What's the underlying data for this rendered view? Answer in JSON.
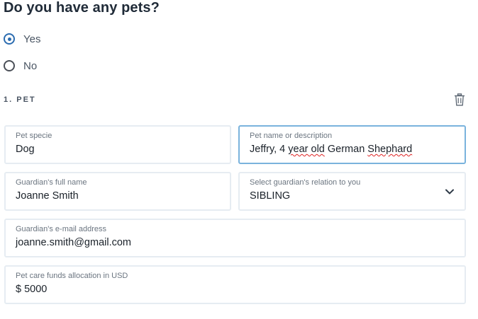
{
  "question": "Do you have any pets?",
  "radio": {
    "options": [
      {
        "label": "Yes",
        "checked": true
      },
      {
        "label": "No",
        "checked": false
      }
    ]
  },
  "section": {
    "title": "1. PET",
    "delete_icon": "trash-icon"
  },
  "fields": {
    "pet_specie": {
      "label": "Pet specie",
      "value": "Dog"
    },
    "pet_name": {
      "label": "Pet name or description",
      "value_part1": "Jeffry, 4 ",
      "value_part2": "year old",
      "value_part3": " German ",
      "value_part4": "Shephard"
    },
    "guardian_name": {
      "label": "Guardian's full name",
      "value": "Joanne Smith"
    },
    "guardian_relation": {
      "label": "Select guardian's relation to you",
      "value": "SIBLING",
      "icon": "chevron-down-icon"
    },
    "guardian_email": {
      "label": "Guardian's e-mail address",
      "value": "joanne.smith@gmail.com"
    },
    "funds": {
      "label": "Pet care funds allocation in USD",
      "value": "$ 5000"
    }
  },
  "colors": {
    "accent": "#2b6cb0",
    "focus_border": "#7ab3dd",
    "field_border": "#e6ecf2"
  }
}
